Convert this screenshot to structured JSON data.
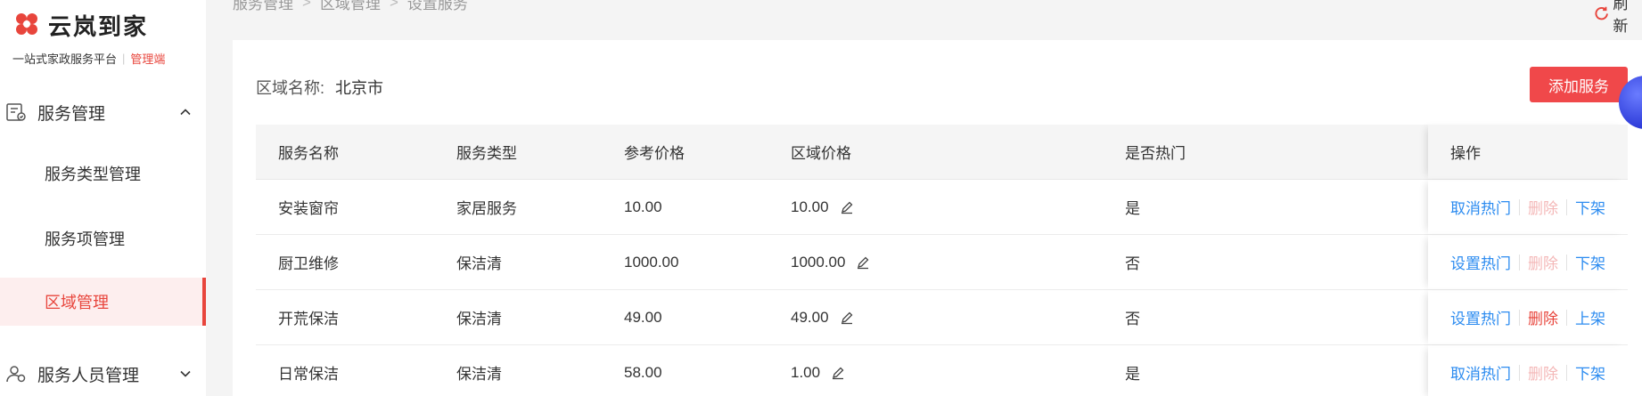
{
  "brand": {
    "name": "云岚到家",
    "slogan": "一站式家政服务平台",
    "tag": "管理端"
  },
  "sidebar": {
    "groups": [
      {
        "label": "服务管理",
        "icon": "service-list-icon",
        "expanded": true
      },
      {
        "label": "服务人员管理",
        "icon": "user-icon",
        "expanded": false
      }
    ],
    "items": [
      {
        "label": "服务类型管理",
        "active": false
      },
      {
        "label": "服务项管理",
        "active": false
      },
      {
        "label": "区域管理",
        "active": true
      }
    ]
  },
  "breadcrumb": [
    "服务管理",
    "区域管理",
    "设置服务"
  ],
  "refresh_label": "刷新",
  "region": {
    "label": "区域名称:",
    "value": "北京市"
  },
  "add_button": "添加服务",
  "table": {
    "headers": [
      "服务名称",
      "服务类型",
      "参考价格",
      "区域价格",
      "是否热门",
      "操作"
    ],
    "rows": [
      {
        "name": "安装窗帘",
        "type": "家居服务",
        "ref_price": "10.00",
        "region_price": "10.00",
        "hot": "是",
        "ops": [
          {
            "label": "取消热门",
            "state": "link"
          },
          {
            "label": "删除",
            "state": "disabled"
          },
          {
            "label": "下架",
            "state": "link"
          }
        ]
      },
      {
        "name": "厨卫维修",
        "type": "保洁清",
        "ref_price": "1000.00",
        "region_price": "1000.00",
        "hot": "否",
        "ops": [
          {
            "label": "设置热门",
            "state": "link"
          },
          {
            "label": "删除",
            "state": "disabled"
          },
          {
            "label": "下架",
            "state": "link"
          }
        ]
      },
      {
        "name": "开荒保洁",
        "type": "保洁清",
        "ref_price": "49.00",
        "region_price": "49.00",
        "hot": "否",
        "ops": [
          {
            "label": "设置热门",
            "state": "link"
          },
          {
            "label": "删除",
            "state": "danger"
          },
          {
            "label": "上架",
            "state": "link"
          }
        ]
      },
      {
        "name": "日常保洁",
        "type": "保洁清",
        "ref_price": "58.00",
        "region_price": "1.00",
        "hot": "是",
        "ops": [
          {
            "label": "取消热门",
            "state": "link"
          },
          {
            "label": "删除",
            "state": "disabled"
          },
          {
            "label": "下架",
            "state": "link"
          }
        ]
      }
    ]
  },
  "colors": {
    "accent": "#e8453c",
    "link": "#2d8cf0",
    "button": "#f0484a",
    "disabled": "#f4b8b8"
  }
}
